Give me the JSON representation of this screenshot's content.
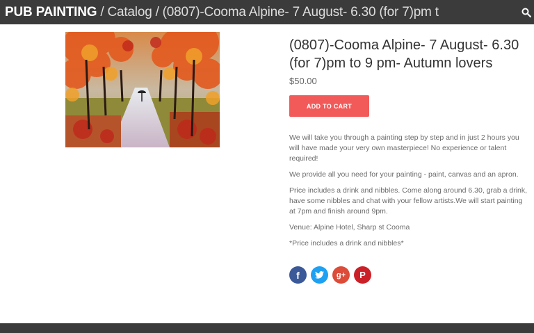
{
  "header": {
    "brand": "PUB PAINTING",
    "separator": "/",
    "catalog_link": "Catalog",
    "current_page": "(0807)-Cooma Alpine- 7 August- 6.30 (for 7)pm t",
    "search_icon": "search-icon"
  },
  "product": {
    "title": "(0807)-Cooma Alpine- 7 August- 6.30 (for 7)pm to 9 pm- Autumn lovers",
    "price": "$50.00",
    "add_to_cart_label": "ADD TO CART",
    "image_subject": "autumn trees painting",
    "description": [
      "We will take you through a painting step by step and in just 2 hours you will have made your very own masterpiece! No experience or talent required!",
      "We provide all you need for your painting - paint, canvas and an apron.",
      "Price includes a drink and nibbles. Come along around 6.30, grab a drink, have some nibbles and chat with your fellow artists.We will start painting at 7pm and finish around 9pm.",
      "Venue: Alpine Hotel, Sharp st Cooma",
      "*Price includes a drink and nibbles*"
    ]
  },
  "share": {
    "facebook": "f",
    "twitter_icon": "twitter-icon",
    "googleplus": "g+",
    "pinterest": "P"
  },
  "colors": {
    "header_bg": "#3b3b3b",
    "cart_button": "#f25a5a",
    "facebook": "#3b5998",
    "twitter": "#1da1f2",
    "googleplus": "#dd4b39",
    "pinterest": "#cb2027"
  }
}
